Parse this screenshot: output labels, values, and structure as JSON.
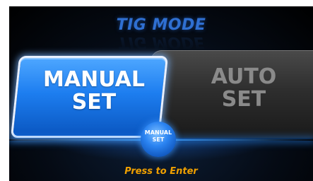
{
  "header": {
    "title": "TIG MODE"
  },
  "options": {
    "manual_label": "MANUAL SET",
    "auto_label": "AUTO SET"
  },
  "selector": {
    "knob_label": "MANUAL SET"
  },
  "footer": {
    "prompt": "Press to Enter"
  },
  "colors": {
    "title": "#2f6fd1",
    "selected": "#1d7ef0",
    "unselected": "#2e2e2e",
    "prompt": "#f0a000"
  }
}
